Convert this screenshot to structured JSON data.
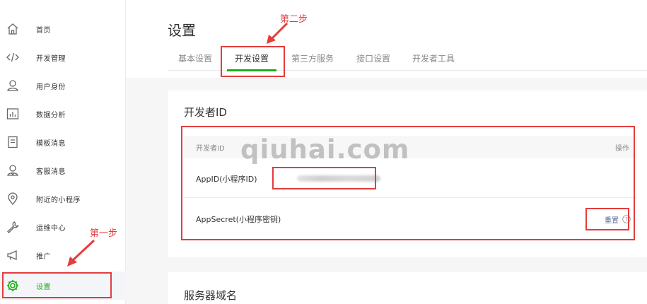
{
  "sidebar": {
    "items": [
      {
        "label": "首页",
        "icon": "home-icon"
      },
      {
        "label": "开发管理",
        "icon": "code-icon"
      },
      {
        "label": "用户身份",
        "icon": "user-icon"
      },
      {
        "label": "数据分析",
        "icon": "chart-icon"
      },
      {
        "label": "模板消息",
        "icon": "document-icon"
      },
      {
        "label": "客服消息",
        "icon": "support-icon"
      },
      {
        "label": "附近的小程序",
        "icon": "location-icon"
      },
      {
        "label": "运维中心",
        "icon": "wrench-icon"
      },
      {
        "label": "推广",
        "icon": "megaphone-icon"
      },
      {
        "label": "设置",
        "icon": "gear-icon",
        "active": true
      }
    ]
  },
  "header": {
    "title": "设置"
  },
  "tabs": [
    {
      "label": "基本设置"
    },
    {
      "label": "开发设置",
      "active": true
    },
    {
      "label": "第三方服务"
    },
    {
      "label": "接口设置"
    },
    {
      "label": "开发者工具"
    }
  ],
  "developer_id": {
    "title": "开发者ID",
    "columns": {
      "name": "开发者ID",
      "action": "操作"
    },
    "rows": [
      {
        "label": "AppID(小程序ID)"
      },
      {
        "label": "AppSecret(小程序密钥)",
        "action": "重置"
      }
    ]
  },
  "server_domain": {
    "title": "服务器域名"
  },
  "annotations": {
    "step1": "第一步",
    "step2": "第二步",
    "watermark": "qiuhai.com",
    "color": "#e33d3d"
  },
  "colors": {
    "accent": "#1aad19",
    "link": "#576b95"
  }
}
